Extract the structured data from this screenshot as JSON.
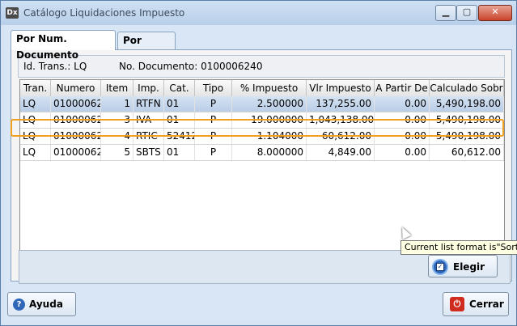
{
  "window": {
    "title": "Catálogo Liquidaciones Impuesto",
    "app_icon": "Dx"
  },
  "tabs": [
    {
      "label": "Por Num. Documento",
      "active": true
    },
    {
      "label": "Por Prefijo",
      "active": false
    }
  ],
  "info": {
    "trans_label": "Id. Trans.: LQ",
    "doc_label": "No. Documento: 0100006240"
  },
  "grid": {
    "columns": [
      "Tran.",
      "Numero",
      "Item",
      "Imp.",
      "Cat.",
      "Tipo",
      "% Impuesto",
      "Vlr Impuesto",
      "A Partir De",
      "Calculado Sobr"
    ],
    "rows": [
      [
        "LQ",
        "01000062",
        "1",
        "RTFN",
        "01",
        "P",
        "2.500000",
        "137,255.00",
        "0.00",
        "5,490,198.00"
      ],
      [
        "LQ",
        "01000062",
        "3",
        "IVA",
        "01",
        "P",
        "19.000000",
        "1,043,138.00",
        "0.00",
        "5,490,198.00"
      ],
      [
        "LQ",
        "01000062",
        "4",
        "RTIC",
        "52412",
        "P",
        "1.104000",
        "60,612.00",
        "0.00",
        "5,490,198.00"
      ],
      [
        "LQ",
        "01000062",
        "5",
        "SBTS",
        "01",
        "P",
        "8.000000",
        "4,849.00",
        "0.00",
        "60,612.00"
      ]
    ],
    "selected_row": 0,
    "highlighted_row": 3,
    "nav_buttons": [
      "|◀",
      "◀◀",
      "◀",
      "?",
      "▶",
      "▶▶",
      "▶|"
    ]
  },
  "buttons": {
    "elegir": "Elegir",
    "ayuda": "Ayuda",
    "cerrar": "Cerrar"
  },
  "tooltip": "Current list format is\"SortO",
  "colors": {
    "highlight": "#f0a020",
    "close": "#c9442c",
    "selection": "#b9cde6"
  }
}
